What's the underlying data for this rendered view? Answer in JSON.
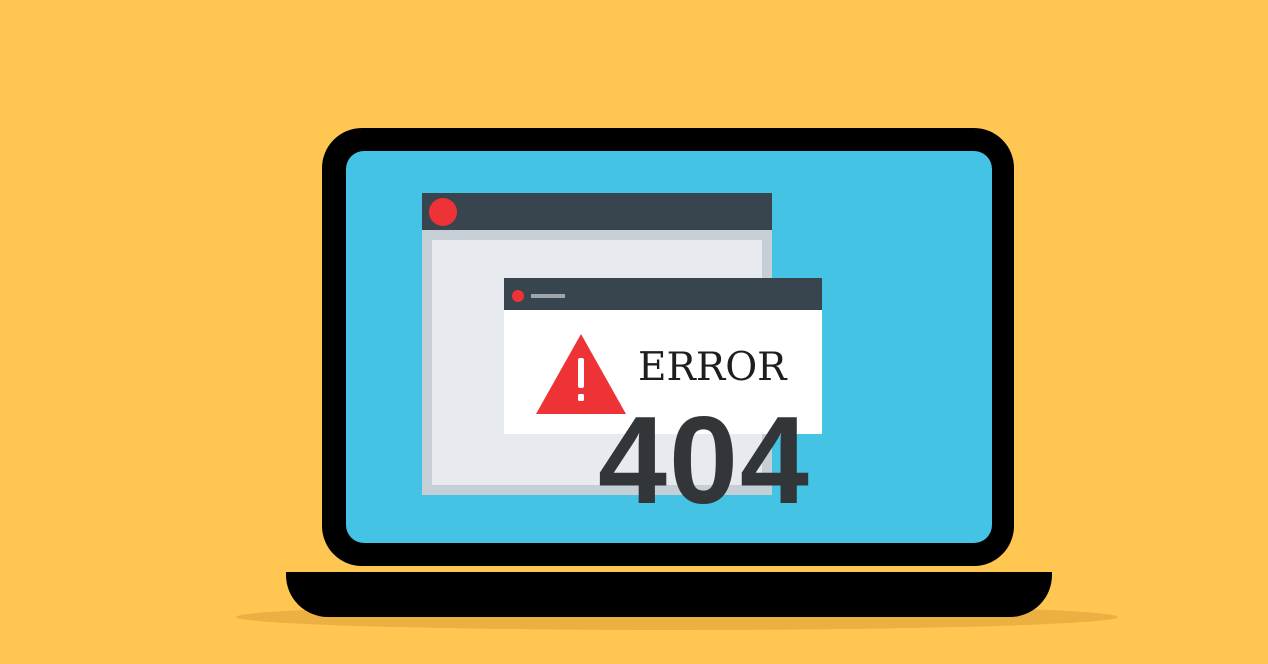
{
  "error_dialog": {
    "title": "ERROR",
    "code": "404",
    "icon": "warning-icon"
  },
  "colors": {
    "background": "#FFC752",
    "screen": "#44C3E4",
    "window_titlebar": "#39454E",
    "close_dot": "#EE3336",
    "warning": "#EE3336",
    "code_text": "#333638"
  }
}
